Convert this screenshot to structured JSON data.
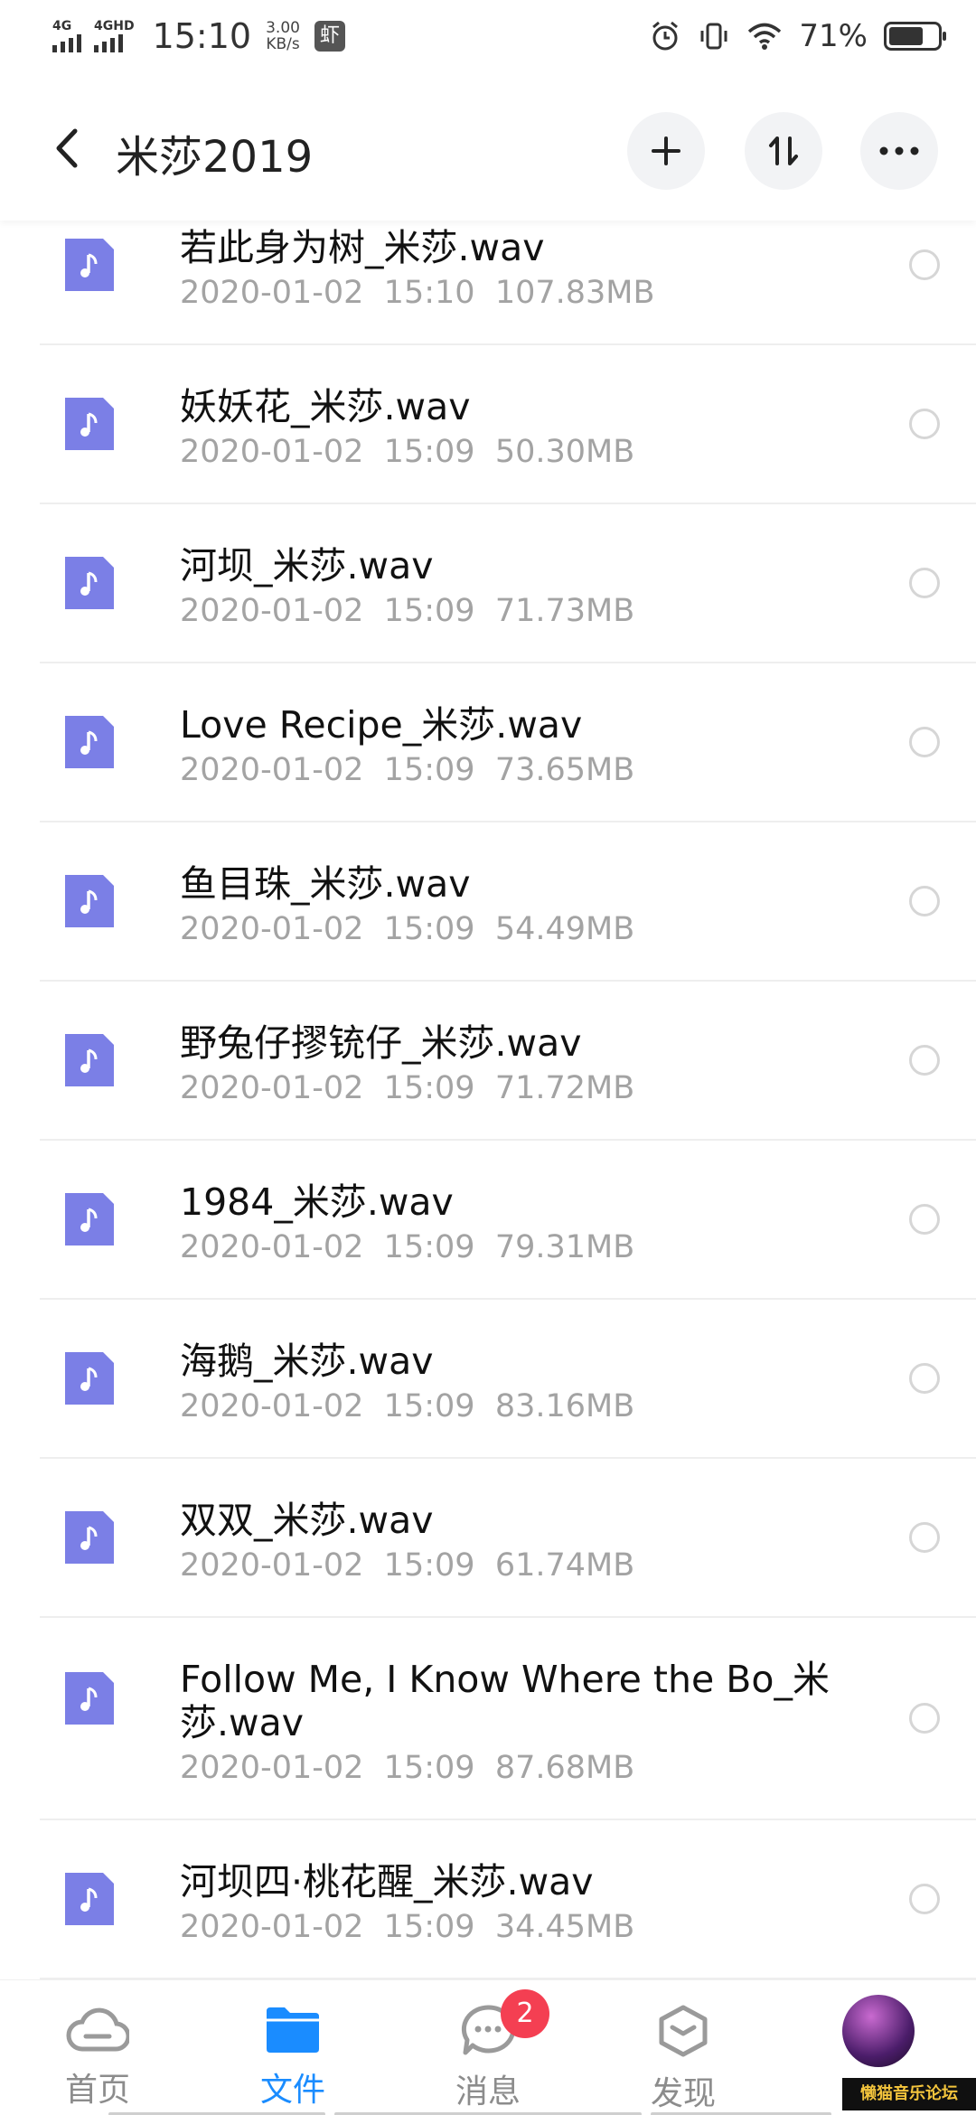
{
  "status_bar": {
    "net1": "4G",
    "net2": "4GHD",
    "time": "15:10",
    "speed_value": "3.00",
    "speed_unit": "KB/s",
    "app_badge": "虾",
    "battery_pct": "71%",
    "battery_level": 0.71,
    "icons": [
      "alarm-icon",
      "vibrate-icon",
      "wifi-icon",
      "battery-icon"
    ]
  },
  "header": {
    "title": "米莎2019",
    "buttons": [
      "back-icon",
      "plus-icon",
      "sort-icon",
      "more-icon"
    ]
  },
  "files": [
    {
      "name": "若此身为树_米莎.wav",
      "date": "2020-01-02",
      "time": "15:10",
      "size": "107.83MB"
    },
    {
      "name": "妖妖花_米莎.wav",
      "date": "2020-01-02",
      "time": "15:09",
      "size": "50.30MB"
    },
    {
      "name": "河坝_米莎.wav",
      "date": "2020-01-02",
      "time": "15:09",
      "size": "71.73MB"
    },
    {
      "name": "Love Recipe_米莎.wav",
      "date": "2020-01-02",
      "time": "15:09",
      "size": "73.65MB"
    },
    {
      "name": "鱼目珠_米莎.wav",
      "date": "2020-01-02",
      "time": "15:09",
      "size": "54.49MB"
    },
    {
      "name": "野兔仔摎铳仔_米莎.wav",
      "date": "2020-01-02",
      "time": "15:09",
      "size": "71.72MB"
    },
    {
      "name": "1984_米莎.wav",
      "date": "2020-01-02",
      "time": "15:09",
      "size": "79.31MB"
    },
    {
      "name": "海鹅_米莎.wav",
      "date": "2020-01-02",
      "time": "15:09",
      "size": "83.16MB"
    },
    {
      "name": "双双_米莎.wav",
      "date": "2020-01-02",
      "time": "15:09",
      "size": "61.74MB"
    },
    {
      "name": "Follow Me, I Know Where the Bo_米莎.wav",
      "date": "2020-01-02",
      "time": "15:09",
      "size": "87.68MB"
    },
    {
      "name": "河坝四·桃花醒_米莎.wav",
      "date": "2020-01-02",
      "time": "15:09",
      "size": "34.45MB"
    }
  ],
  "bottom_nav": {
    "items": [
      {
        "label": "首页",
        "icon": "cloud-icon"
      },
      {
        "label": "文件",
        "icon": "folder-icon"
      },
      {
        "label": "消息",
        "icon": "chat-icon",
        "badge": "2"
      },
      {
        "label": "发现",
        "icon": "cube-icon"
      }
    ],
    "watermark": "懒猫音乐论坛"
  },
  "colors": {
    "accent": "#1a8cff",
    "file_icon": "#7b7fe6",
    "badge": "#f43f52",
    "meta_text": "#a3a3a3"
  }
}
